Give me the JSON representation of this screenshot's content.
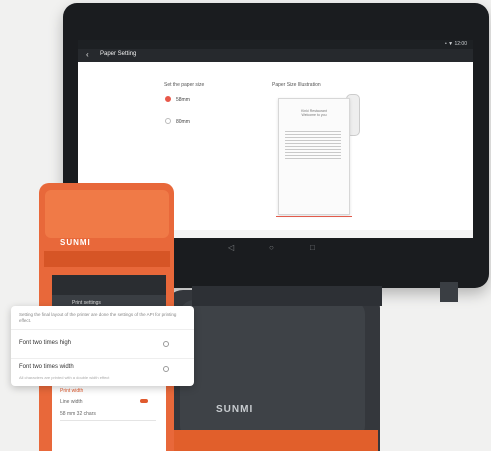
{
  "terminal": {
    "status_text": "• ▼ 12:00",
    "app_title": "Paper Setting",
    "left_heading": "Set the paper size",
    "options": [
      "58mm",
      "80mm"
    ],
    "selected_option": "58mm",
    "right_heading": "Paper Size Illustration",
    "receipt_header": "Kinki Restaurant\nWelcome to you",
    "nav_icons": [
      "back-icon",
      "home-icon",
      "recents-icon"
    ]
  },
  "stand": {
    "brand": "SUNMI"
  },
  "handheld": {
    "brand": "SUNMI",
    "app_title": "Print settings",
    "section_label": "Print width",
    "line1": "Line width",
    "line2": "58 mm 32 chars"
  },
  "popup": {
    "description": "Setting the final layout of the printer are done the settings of the API for printing effect.",
    "rows": [
      {
        "label": "Font two times high",
        "sub": ""
      },
      {
        "label": "Font two times width",
        "sub": "All characters are printed with a double width effect"
      }
    ]
  },
  "colors": {
    "accent": "#e8584a",
    "device_orange": "#e8683a",
    "bezel": "#1a1c1f"
  }
}
